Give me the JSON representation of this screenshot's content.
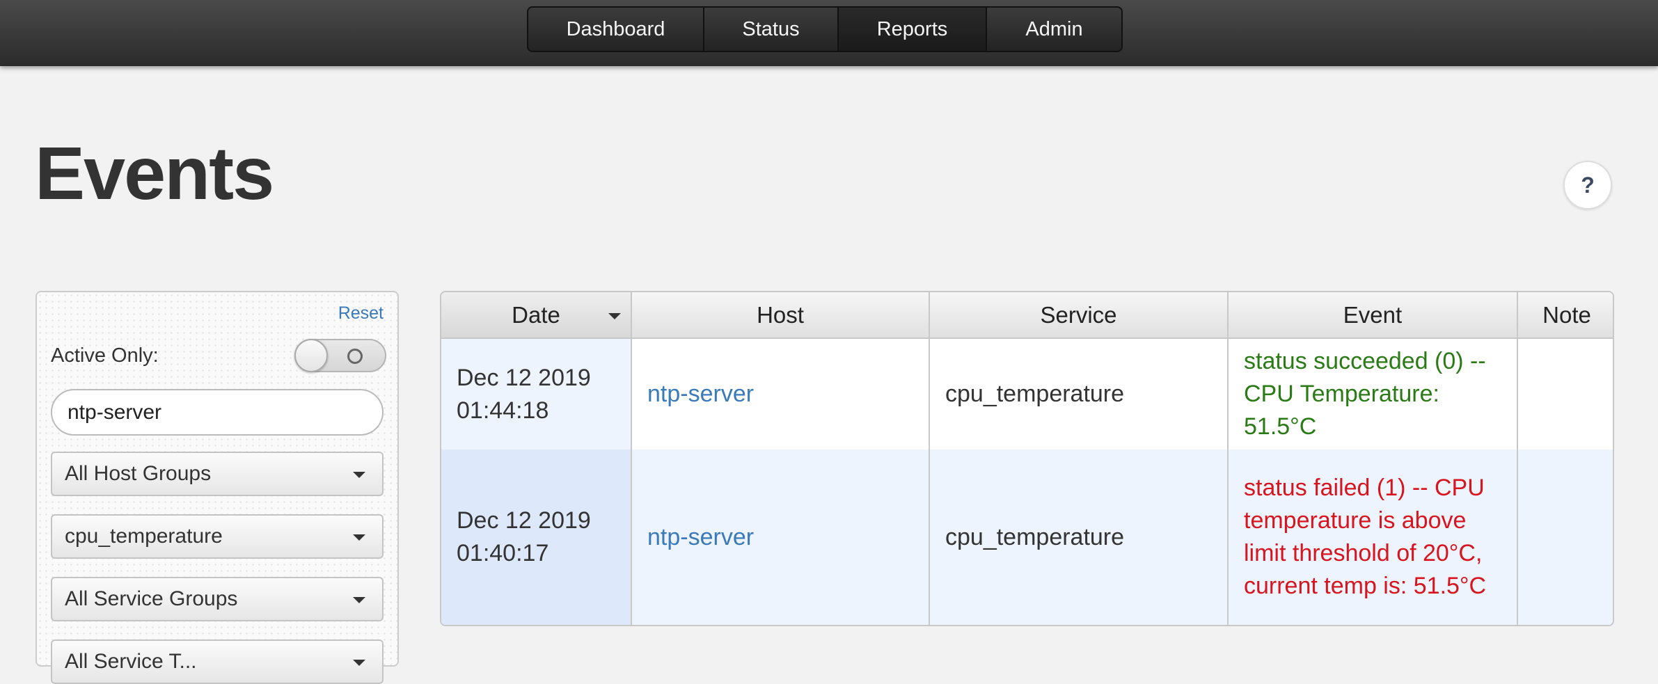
{
  "nav": {
    "items": [
      {
        "label": "Dashboard"
      },
      {
        "label": "Status"
      },
      {
        "label": "Reports"
      },
      {
        "label": "Admin"
      }
    ]
  },
  "page": {
    "title": "Events",
    "help_label": "?"
  },
  "filters": {
    "reset_label": "Reset",
    "active_only_label": "Active Only:",
    "active_only_value": false,
    "search_value": "ntp-server",
    "host_group": "All Host Groups",
    "service": "cpu_temperature",
    "service_group": "All Service Groups",
    "service_type_partial": "All Service T..."
  },
  "table": {
    "columns": [
      "Date",
      "Host",
      "Service",
      "Event",
      "Note"
    ],
    "sorted_column": "Date",
    "rows": [
      {
        "date": "Dec 12 2019",
        "time": "01:44:18",
        "host": "ntp-server",
        "service": "cpu_temperature",
        "event": "status succeeded (0) -- CPU Temperature: 51.5°C",
        "status": "ok",
        "note": ""
      },
      {
        "date": "Dec 12 2019",
        "time": "01:40:17",
        "host": "ntp-server",
        "service": "cpu_temperature",
        "event": "status failed (1) -- CPU temperature is above limit threshold of 20°C, current temp is: 51.5°C",
        "status": "fail",
        "note": ""
      }
    ]
  },
  "colors": {
    "link": "#3a7ab8",
    "success": "#2a7a15",
    "failure": "#d8141e"
  }
}
